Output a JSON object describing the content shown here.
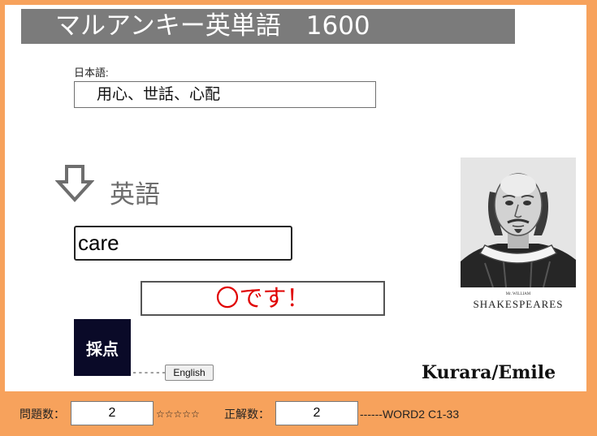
{
  "app": {
    "title": "マルアンキー英単語　1600"
  },
  "japanese": {
    "label": "日本語:",
    "meaning": "用心、世話、心配"
  },
  "english": {
    "heading": "英語",
    "answer_value": "care"
  },
  "result": {
    "text": "〇です！"
  },
  "buttons": {
    "score_label": "採点",
    "english_label": "English",
    "dash": "------"
  },
  "portrait": {
    "caption_small": "Mr. WILLIAM",
    "caption": "SHAKESPEARES"
  },
  "credit": "Kurara/Emile",
  "footer": {
    "question_count_label": "問題数：",
    "question_count_value": "2",
    "stars": "☆☆☆☆☆",
    "correct_label": "正解数：",
    "correct_value": "2",
    "set_label": "------WORD2 C1-33"
  },
  "colors": {
    "page_bg": "#f7a25c",
    "title_bg": "#7b7b7b",
    "score_button_bg": "#0a0a28",
    "result_text": "#e00000"
  },
  "icons": {
    "arrow": "down-arrow-icon",
    "portrait": "shakespeare-portrait"
  }
}
